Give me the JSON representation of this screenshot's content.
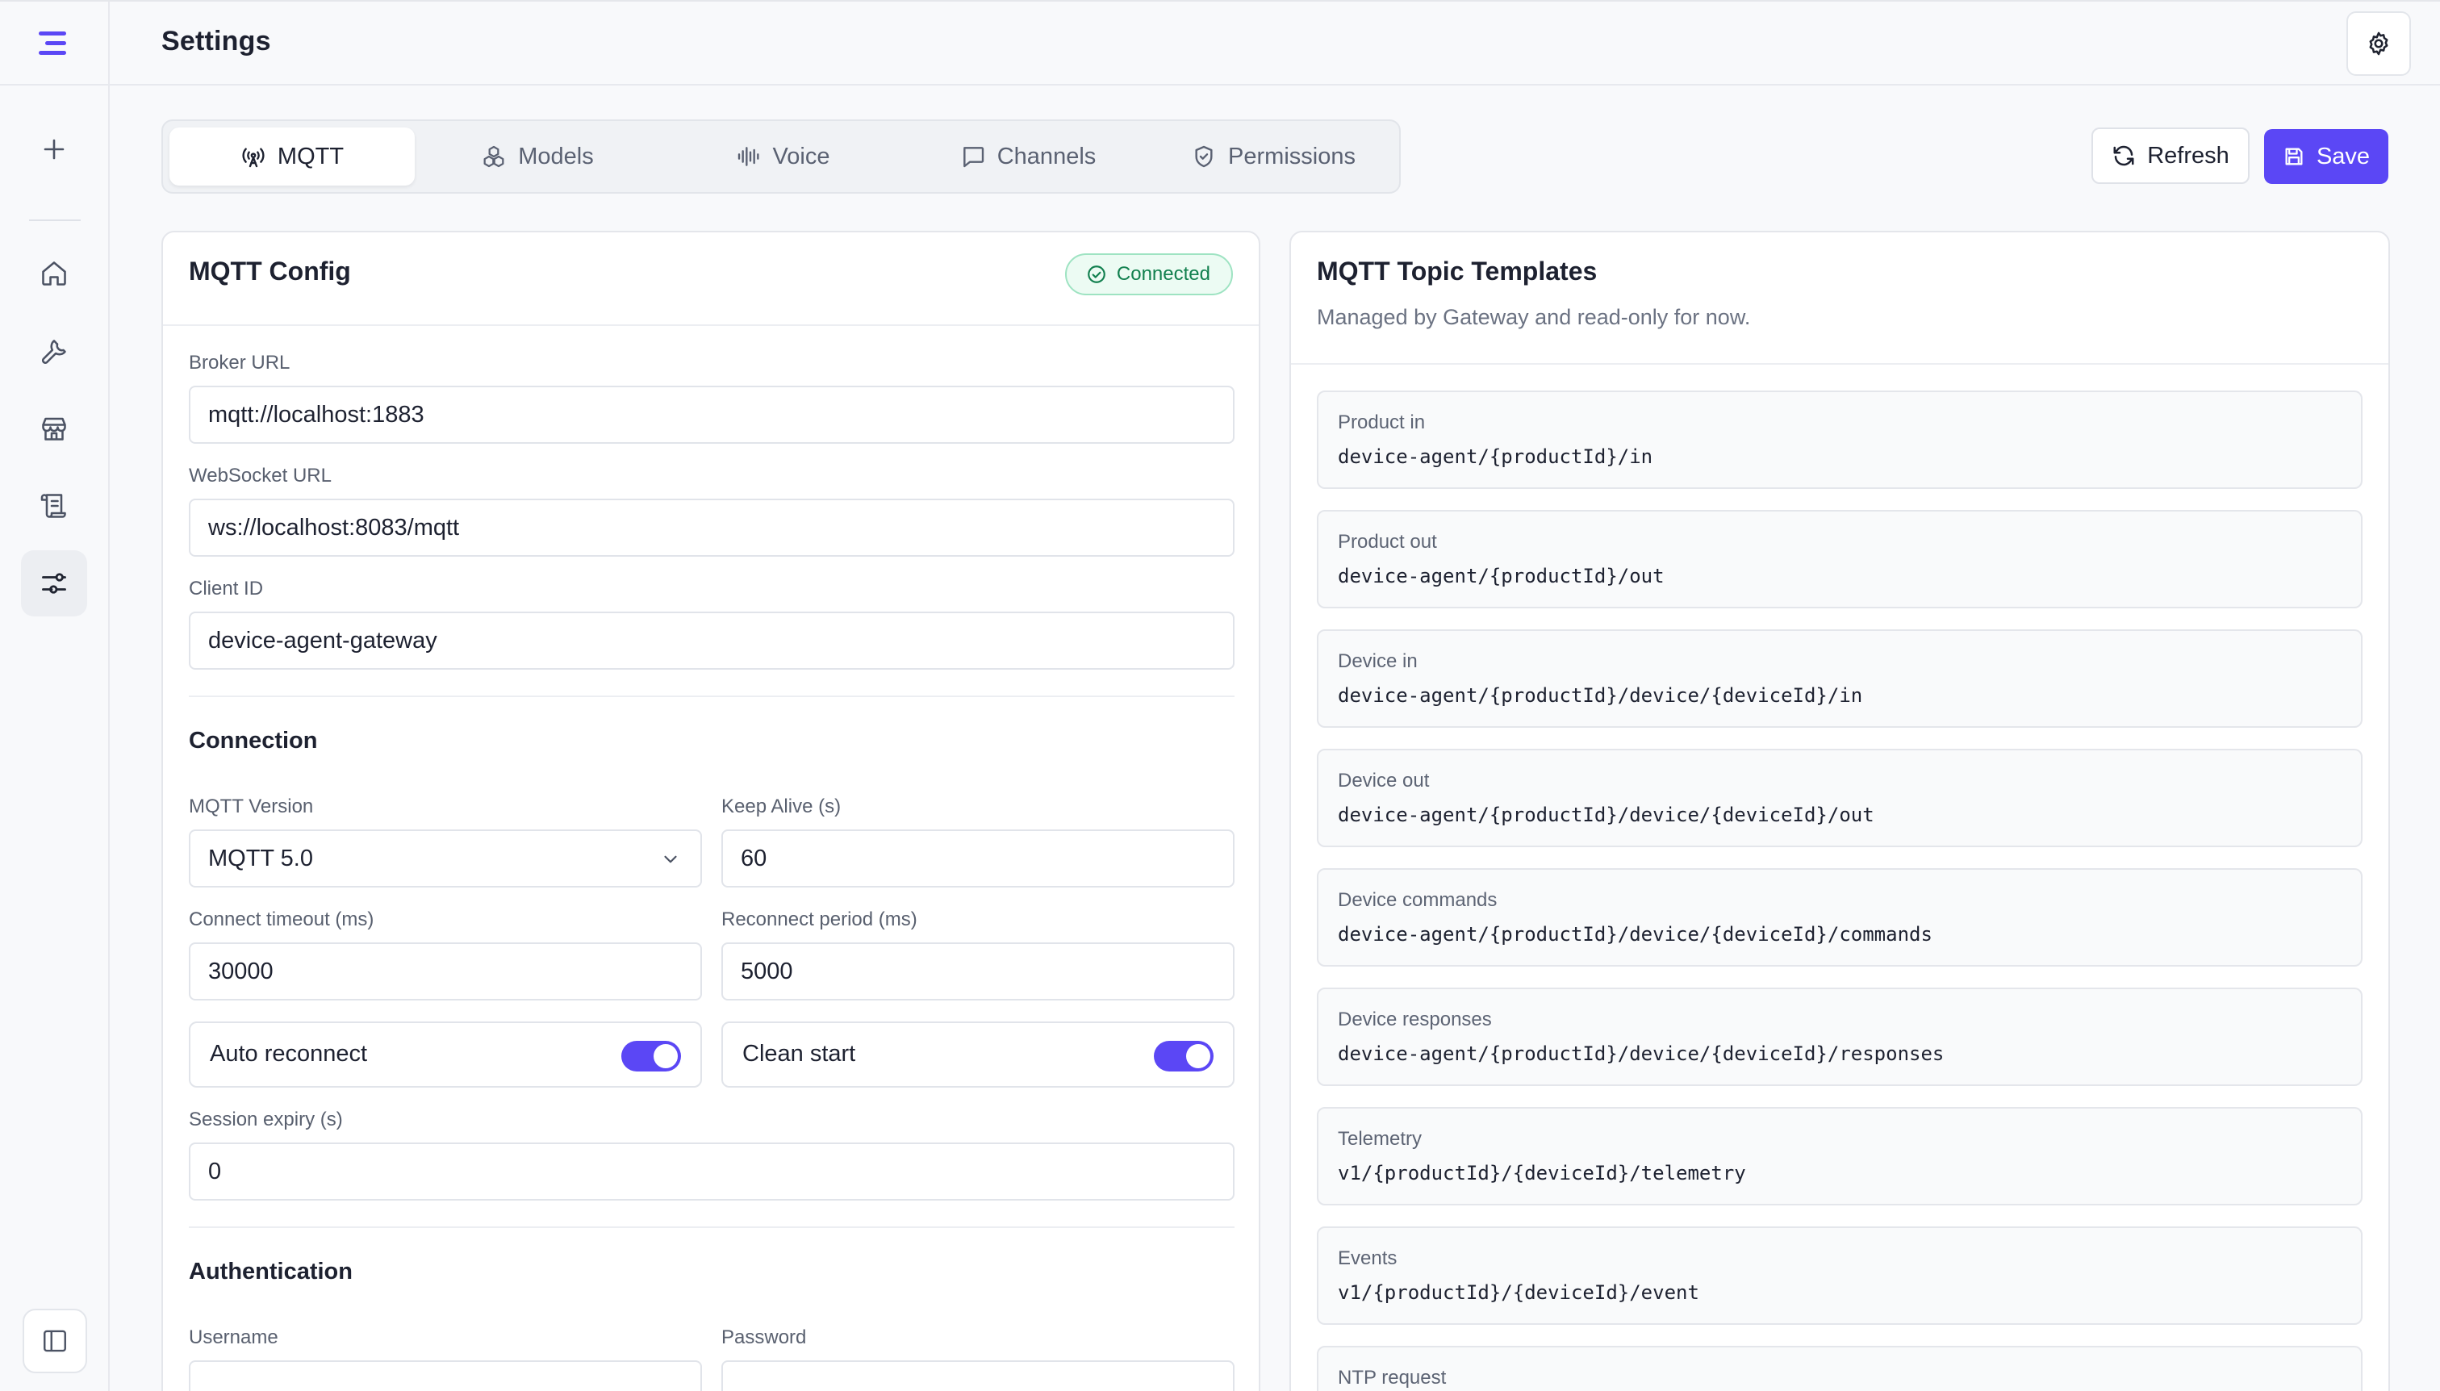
{
  "header": {
    "title": "Settings"
  },
  "sidebar": {
    "items": [
      {
        "icon": "plus-icon"
      },
      {
        "icon": "home-icon"
      },
      {
        "icon": "wrench-icon"
      },
      {
        "icon": "store-icon"
      },
      {
        "icon": "scroll-icon"
      },
      {
        "icon": "sliders-icon",
        "active": true
      }
    ]
  },
  "tabs": [
    {
      "label": "MQTT",
      "icon": "antenna-icon",
      "active": true
    },
    {
      "label": "Models",
      "icon": "models-icon"
    },
    {
      "label": "Voice",
      "icon": "waveform-icon"
    },
    {
      "label": "Channels",
      "icon": "chat-icon"
    },
    {
      "label": "Permissions",
      "icon": "shield-icon"
    }
  ],
  "actions": {
    "refresh_label": "Refresh",
    "save_label": "Save"
  },
  "mqtt_config": {
    "title": "MQTT Config",
    "status": "Connected",
    "broker_url": {
      "label": "Broker URL",
      "value": "mqtt://localhost:1883"
    },
    "websocket_url": {
      "label": "WebSocket URL",
      "value": "ws://localhost:8083/mqtt"
    },
    "client_id": {
      "label": "Client ID",
      "value": "device-agent-gateway"
    },
    "connection": {
      "title": "Connection",
      "mqtt_version": {
        "label": "MQTT Version",
        "value": "MQTT 5.0"
      },
      "keep_alive": {
        "label": "Keep Alive (s)",
        "value": "60"
      },
      "connect_timeout": {
        "label": "Connect timeout (ms)",
        "value": "30000"
      },
      "reconnect_period": {
        "label": "Reconnect period (ms)",
        "value": "5000"
      },
      "auto_reconnect": {
        "label": "Auto reconnect",
        "on": true
      },
      "clean_start": {
        "label": "Clean start",
        "on": true
      },
      "session_expiry": {
        "label": "Session expiry (s)",
        "value": "0"
      }
    },
    "authentication": {
      "title": "Authentication",
      "username": {
        "label": "Username",
        "value": ""
      },
      "password": {
        "label": "Password",
        "value": ""
      }
    }
  },
  "topic_templates": {
    "title": "MQTT Topic Templates",
    "subtitle": "Managed by Gateway and read-only for now.",
    "items": [
      {
        "label": "Product in",
        "value": "device-agent/{productId}/in"
      },
      {
        "label": "Product out",
        "value": "device-agent/{productId}/out"
      },
      {
        "label": "Device in",
        "value": "device-agent/{productId}/device/{deviceId}/in"
      },
      {
        "label": "Device out",
        "value": "device-agent/{productId}/device/{deviceId}/out"
      },
      {
        "label": "Device commands",
        "value": "device-agent/{productId}/device/{deviceId}/commands"
      },
      {
        "label": "Device responses",
        "value": "device-agent/{productId}/device/{deviceId}/responses"
      },
      {
        "label": "Telemetry",
        "value": "v1/{productId}/{deviceId}/telemetry"
      },
      {
        "label": "Events",
        "value": "v1/{productId}/{deviceId}/event"
      },
      {
        "label": "NTP request",
        "value": ""
      }
    ]
  },
  "colors": {
    "accent": "#5b47f5",
    "success": "#12804f"
  }
}
